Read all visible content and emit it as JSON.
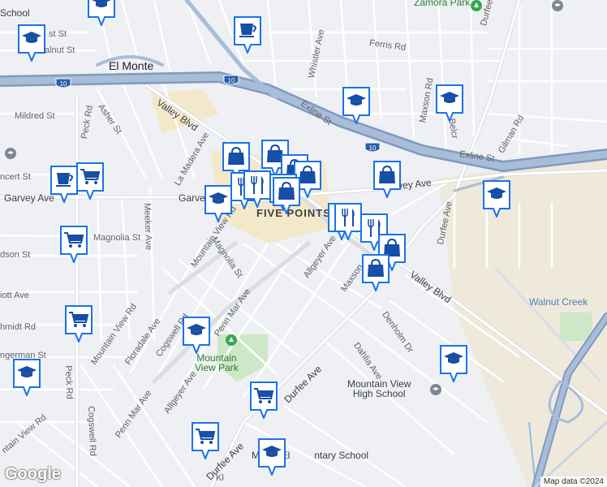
{
  "labels": {
    "school_top": "School",
    "zamora_park": "Zamora Park",
    "durfee_top": "Durfee Ave",
    "st_frag": "st St",
    "walnut_st": "alnut St",
    "whistler": "Whistler Ave",
    "ferris": "Ferris Rd",
    "el_monte": "El Monte",
    "mildred": "Mildred St",
    "asher": "Asher St",
    "peck_top": "Peck Rd",
    "valley_top": "Valley Blvd",
    "exline1": "Exline St",
    "maxson_rd": "Maxson Rd",
    "belcr": "Belcr",
    "gilman": "Gilman Rd",
    "exline2": "Exline St",
    "concert": "ncert St",
    "la_madera": "La Madera Ave",
    "garvey_left": "Garvey Ave",
    "garvey_mid": "Garve",
    "garvey_right": "Garvey Ave",
    "five_points": "FIVE POINTS",
    "meeker": "Meeker Ave",
    "magnolia_st": "Magnolia St",
    "mountain_view_rd1": "Mountain View Rd",
    "magnolia_st2": "Magnolia St",
    "allgeyer_top": "Allgeyer Ave",
    "durfee_mid": "Durfee Ave",
    "dson": "dson St",
    "elliott": "iott Ave",
    "valley_right": "Valley Blvd",
    "walnut_creek": "Walnut Creek",
    "maxson2": "Maxson",
    "schmidt": "hmidt Rd",
    "mountain_view_rd2": "Mountain View Rd",
    "floradale": "Floradale Ave",
    "cogswell": "Cogswell Rd",
    "penn_mar": "Penn Mar Ave",
    "denholm": "Denholm Dr",
    "dahlia": "Dahlia Ave",
    "german": "ngerman St",
    "mv_park": "Mountain\nView Park",
    "mv_high": "Mountain View\nHigh School",
    "allgeyer_bot": "Allgeyer Ave",
    "durfee_bot": "Durfee Ave",
    "peck_bot": "Peck Rd",
    "penn_mar2": "Penn Mar Ave",
    "cogswell2": "Cogswell Rd",
    "mountain_view_rd3": "ntain View Rd",
    "durfee_bot2": "Durfee Ave",
    "elem_school": "M        El         ntary School",
    "kl": "Kl"
  },
  "shields": {
    "i10_left": "10",
    "i10_mid": "10",
    "i10_right": "10"
  },
  "attribution": "Map data ©2024",
  "logo": "Google",
  "colors": {
    "pin_fill": "#ffffff",
    "pin_border": "#1a73e8",
    "icon": "#174ea6",
    "freeway": "#8aa4c8",
    "park": "#cde8c6",
    "commercial": "#f3e8c9"
  },
  "pins": [
    {
      "icon": "school-icon"
    },
    {
      "icon": "coffee-icon"
    },
    {
      "icon": "school-icon"
    },
    {
      "icon": "school-icon"
    },
    {
      "icon": "school-icon"
    },
    {
      "icon": "coffee-icon"
    },
    {
      "icon": "cart-icon"
    },
    {
      "icon": "shopping-bag-icon"
    },
    {
      "icon": "shopping-bag-icon"
    },
    {
      "icon": "shopping-bag-icon"
    },
    {
      "icon": "shopping-bag-icon"
    },
    {
      "icon": "shopping-bag-icon"
    },
    {
      "icon": "restaurant-icon"
    },
    {
      "icon": "restaurant-icon"
    },
    {
      "icon": "school-icon"
    },
    {
      "icon": "shopping-bag-icon"
    },
    {
      "icon": "shopping-bag-icon"
    },
    {
      "icon": "restaurant-icon"
    },
    {
      "icon": "restaurant-icon"
    },
    {
      "icon": "restaurant-icon"
    },
    {
      "icon": "shopping-bag-icon"
    },
    {
      "icon": "shopping-bag-icon"
    },
    {
      "icon": "school-icon"
    },
    {
      "icon": "cart-icon"
    },
    {
      "icon": "cart-icon"
    },
    {
      "icon": "school-icon"
    },
    {
      "icon": "school-icon"
    },
    {
      "icon": "school-icon"
    },
    {
      "icon": "cart-icon"
    },
    {
      "icon": "cart-icon"
    },
    {
      "icon": "school-icon"
    }
  ]
}
